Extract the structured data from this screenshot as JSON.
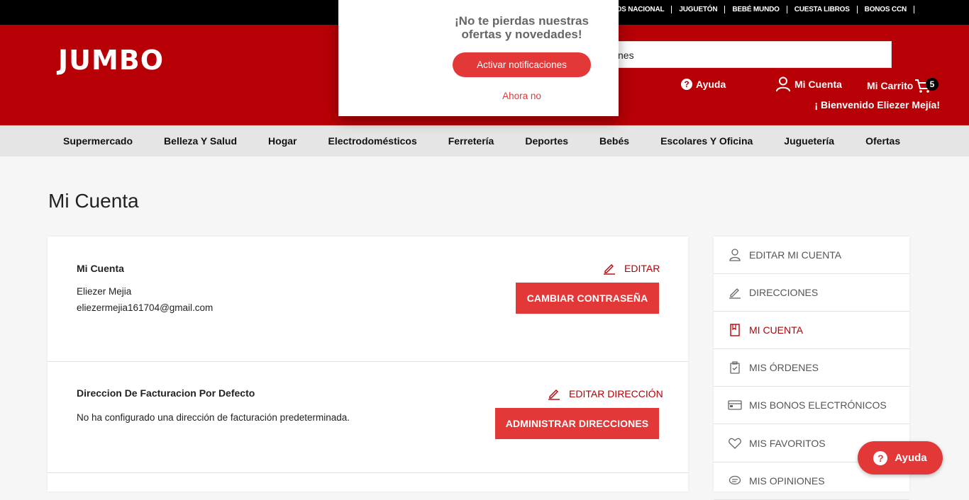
{
  "topbar": {
    "links": [
      "DOS NACIONAL",
      "JUGUETÓN",
      "BEBÉ MUNDO",
      "CUESTA LIBROS",
      "BONOS CCN"
    ]
  },
  "header": {
    "logo": "JUMBO",
    "search_value": "nes",
    "help_label": "Ayuda",
    "account_label": "Mi Cuenta",
    "cart_label": "Mi Carrito",
    "cart_count": "5",
    "welcome": "¡ Bienvenido Eliezer Mejía!"
  },
  "categories": [
    "Supermercado",
    "Belleza Y Salud",
    "Hogar",
    "Electrodomésticos",
    "Ferretería",
    "Deportes",
    "Bebés",
    "Escolares Y Oficina",
    "Juguetería",
    "Ofertas"
  ],
  "page_title": "Mi Cuenta",
  "account_section": {
    "title": "Mi Cuenta",
    "name": "Eliezer Mejia",
    "email": "eliezermejia161704@gmail.com",
    "edit_label": "EDITAR",
    "change_password_label": "CAMBIAR CONTRASEÑA"
  },
  "billing_section": {
    "title": "Direccion De Facturacion Por Defecto",
    "text": "No ha configurado una dirección de facturación predeterminada.",
    "edit_label": "EDITAR DIRECCIÓN",
    "manage_label": "ADMINISTRAR DIRECCIONES"
  },
  "sidebar": {
    "items": [
      {
        "label": "EDITAR MI CUENTA",
        "icon": "user-icon"
      },
      {
        "label": "DIRECCIONES",
        "icon": "pencil-icon"
      },
      {
        "label": "MI CUENTA",
        "icon": "bookmark-icon",
        "active": true
      },
      {
        "label": "MIS ÓRDENES",
        "icon": "clipboard-icon"
      },
      {
        "label": "MIS BONOS ELECTRÓNICOS",
        "icon": "card-icon"
      },
      {
        "label": "MIS FAVORITOS",
        "icon": "heart-icon"
      },
      {
        "label": "MIS OPINIONES",
        "icon": "comment-icon"
      }
    ]
  },
  "popup": {
    "title": "¡No te pierdas nuestras ofertas y novedades!",
    "activate_label": "Activar notificaciones",
    "later_label": "Ahora no"
  },
  "help_float_label": "Ayuda",
  "colors": {
    "brand_red": "#b70006",
    "button_red": "#e33838",
    "topbar": "#000000",
    "nav_bg": "#e5e5e5"
  }
}
